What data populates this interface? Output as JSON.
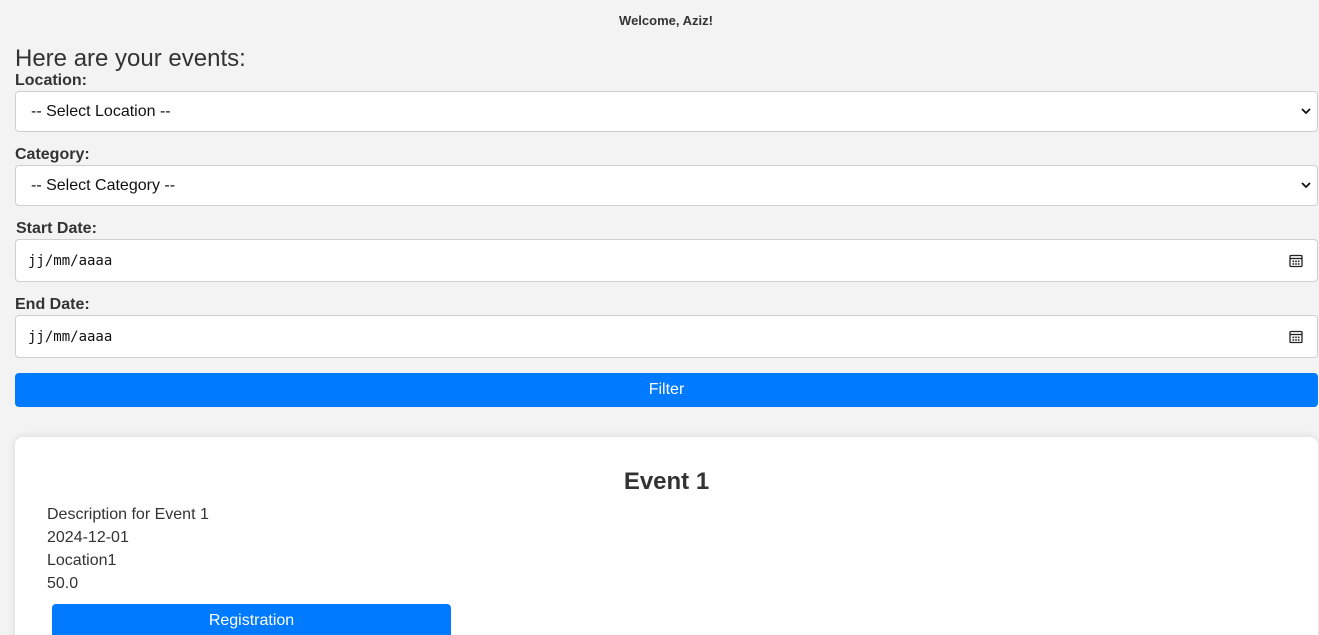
{
  "header": {
    "welcome_text": "Welcome, Aziz!",
    "heading": "Here are your events:"
  },
  "filters": {
    "location": {
      "label": "Location:",
      "selected": "-- Select Location --"
    },
    "category": {
      "label": "Category:",
      "selected": "-- Select Category --"
    },
    "start_date": {
      "label": "Start Date:",
      "value": "jj/mm/aaaa"
    },
    "end_date": {
      "label": "End Date:",
      "value": "jj/mm/aaaa"
    },
    "filter_button_label": "Filter"
  },
  "events": [
    {
      "title": "Event 1",
      "description": "Description for Event 1",
      "date": "2024-12-01",
      "location": "Location1",
      "price": "50.0",
      "button_label": "Registration"
    }
  ],
  "colors": {
    "background": "#f3f3f3",
    "accent": "#007bff",
    "card": "#ffffff",
    "text": "#333333"
  },
  "icons": {
    "select_chevron": "chevron-down-icon",
    "date_picker": "calendar-icon"
  }
}
